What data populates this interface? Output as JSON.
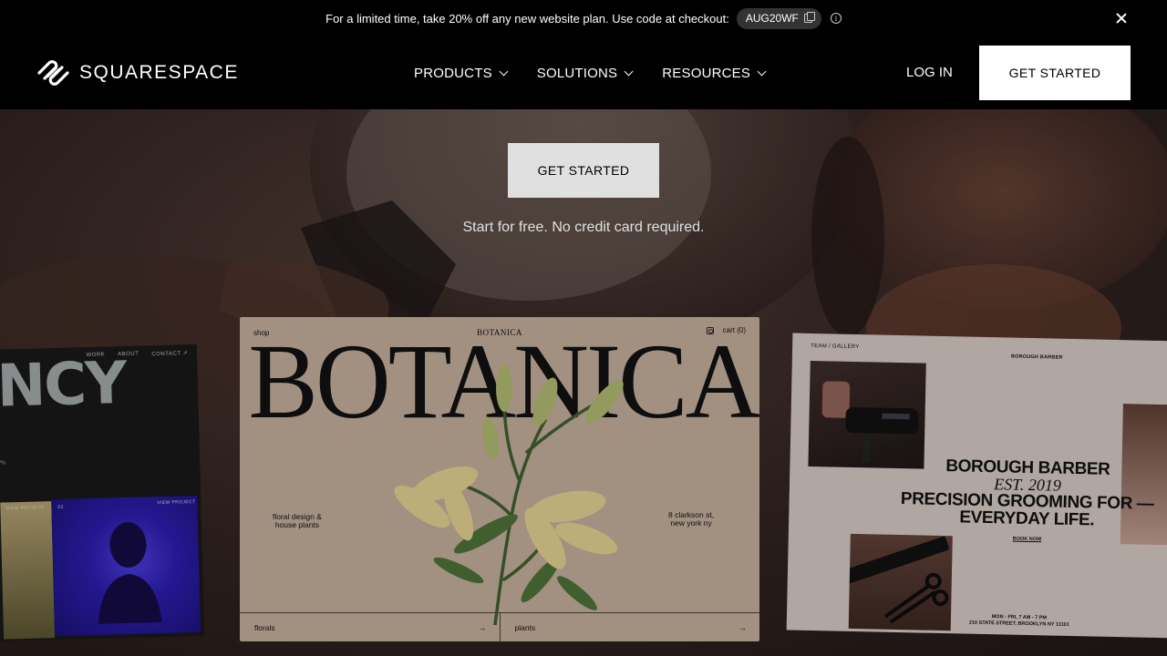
{
  "promo": {
    "text": "For a limited time, take 20% off any new website plan. Use code at checkout:",
    "code": "AUG20WF",
    "info_glyph": "i"
  },
  "header": {
    "logo_text": "SQUARESPACE",
    "nav": [
      {
        "label": "PRODUCTS"
      },
      {
        "label": "SOLUTIONS"
      },
      {
        "label": "RESOURCES"
      }
    ],
    "login_label": "LOG IN",
    "cta_label": "GET STARTED"
  },
  "hero": {
    "cta_label": "GET STARTED",
    "subtext": "Start for free. No credit card required."
  },
  "cards": {
    "agency": {
      "title": "ENCY",
      "nav": [
        "WORK",
        "ABOUT",
        "CONTACT ↗"
      ],
      "mark": "/%",
      "label1": "VIEW PROJECT",
      "label2": "03",
      "label3": "VIEW PROJECT"
    },
    "botanica": {
      "shop": "shop",
      "logo": "BOTANICA",
      "cart": "cart (0)",
      "title": "BOTANICA",
      "left_text_1": "floral design &",
      "left_text_2": "house plants",
      "right_text_1": "8 clarkson st,",
      "right_text_2": "new york ny",
      "footer_left": "florals",
      "footer_right": "plants",
      "arrow": "→"
    },
    "barber": {
      "nav": "TEAM / GALLERY",
      "logo": "BOROUGH BARBER",
      "title_1": "BOROUGH BARBER",
      "est": "EST. 2019",
      "title_2": "PRECISION GROOMING FOR —",
      "title_3": "EVERYDAY LIFE.",
      "book": "BOOK NOW",
      "hours": "MON - FRI, 7 AM - 7 PM",
      "address": "210 STATE STREET, BROOKLYN NY 11101"
    }
  },
  "colors": {
    "background": "#000000",
    "hero_tone": "#3a2a26",
    "botanica_bg": "#b9a493",
    "barber_bg": "#c9bfb9",
    "button_bg": "#ffffff"
  }
}
